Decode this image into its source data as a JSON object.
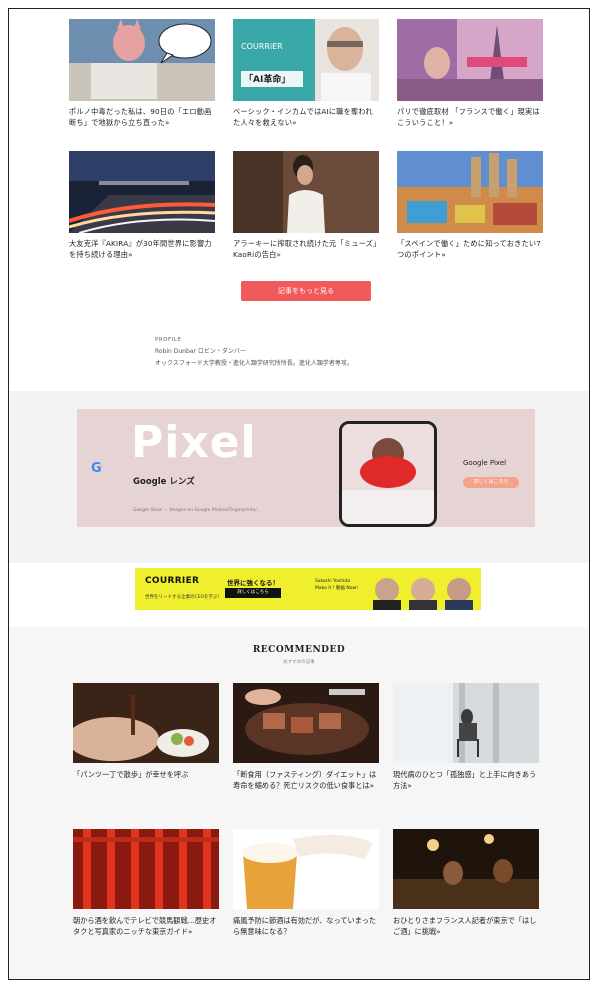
{
  "articles": [
    {
      "caption": "ポルノ中毒だった私は、90日の「エロ動画断ち」で地獄から立ち直った»"
    },
    {
      "caption": "ベーシック・インカムではAIに職を奪われた人々を救えない»",
      "thumb_text": "「AI革命」"
    },
    {
      "caption": "パリで徹底取材 「フランスで働く」現実はこういうこと！»"
    },
    {
      "caption": "大友克洋『AKIRA』が30年間世界に影響力を持ち続ける理由»"
    },
    {
      "caption": "アラーキーに搾取され続けた元「ミューズ」KaoRiの告白»"
    },
    {
      "caption": "「スペインで働く」ために知っておきたい7つのポイント»"
    }
  ],
  "more_button": "記事をもっと見る",
  "profile": {
    "heading": "PROFILE",
    "name": "Robin Dunbar ロビン・ダンバー",
    "bio": "オックスフォード大学教授・進化人類学研究所所長。進化人類学者専攻。"
  },
  "ad": {
    "google_icon": "G",
    "headline": "Pixel",
    "product": "Google レンズ",
    "small_print": "Google Store ・ Images on Google Photos/Fingerprints/...",
    "brand": "Google Pixel",
    "cta": "詳しくはこちら"
  },
  "banner": {
    "logo": "COURRIER",
    "subtitle": "世界をリードする企業のCEOを学ぶ!",
    "headline": "世界に強くなる！",
    "cta": "詳しくはこちら",
    "speaker": "Satoshi Yoshida\nMake it ! 動画 Now!"
  },
  "recommended": {
    "title": "RECOMMENDED",
    "subtitle": "おすすめの記事",
    "items": [
      {
        "caption": "「パンツ一丁で散歩」が幸せを呼ぶ"
      },
      {
        "caption": "「断食用（ファスティング）ダイエット」は寿命を縮める？死亡リスクの低い食事とは»"
      },
      {
        "caption": "現代病のひとつ「孤独感」と上手に向きあう方法»"
      },
      {
        "caption": "朝から酒を飲んでテレビで競馬観戦…歴史オタクと写真家のニッチな東京ガイド»"
      },
      {
        "caption": "痛風予防に節酒は有効だが、なっていまったら無意味になる？"
      },
      {
        "caption": "おひとりさまフランス人記者が東京で「はしご酒」に挑戦»"
      }
    ]
  },
  "colors": {
    "accent": "#f05a5a",
    "ad_bg": "#e6d4d4",
    "banner_bg": "#f0ef2e",
    "band_bg": "#f3f3f3"
  }
}
